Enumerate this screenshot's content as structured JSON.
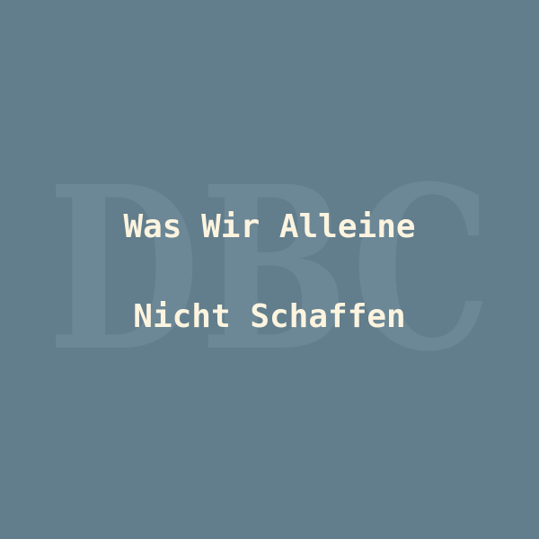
{
  "cover": {
    "background_color": "#627d8c",
    "watermark": {
      "text": "DBC",
      "color": "#6c8796"
    },
    "title": {
      "color": "#fcf4df",
      "lines": [
        "Was Wir Alleine",
        "Nicht Schaffen"
      ]
    }
  }
}
